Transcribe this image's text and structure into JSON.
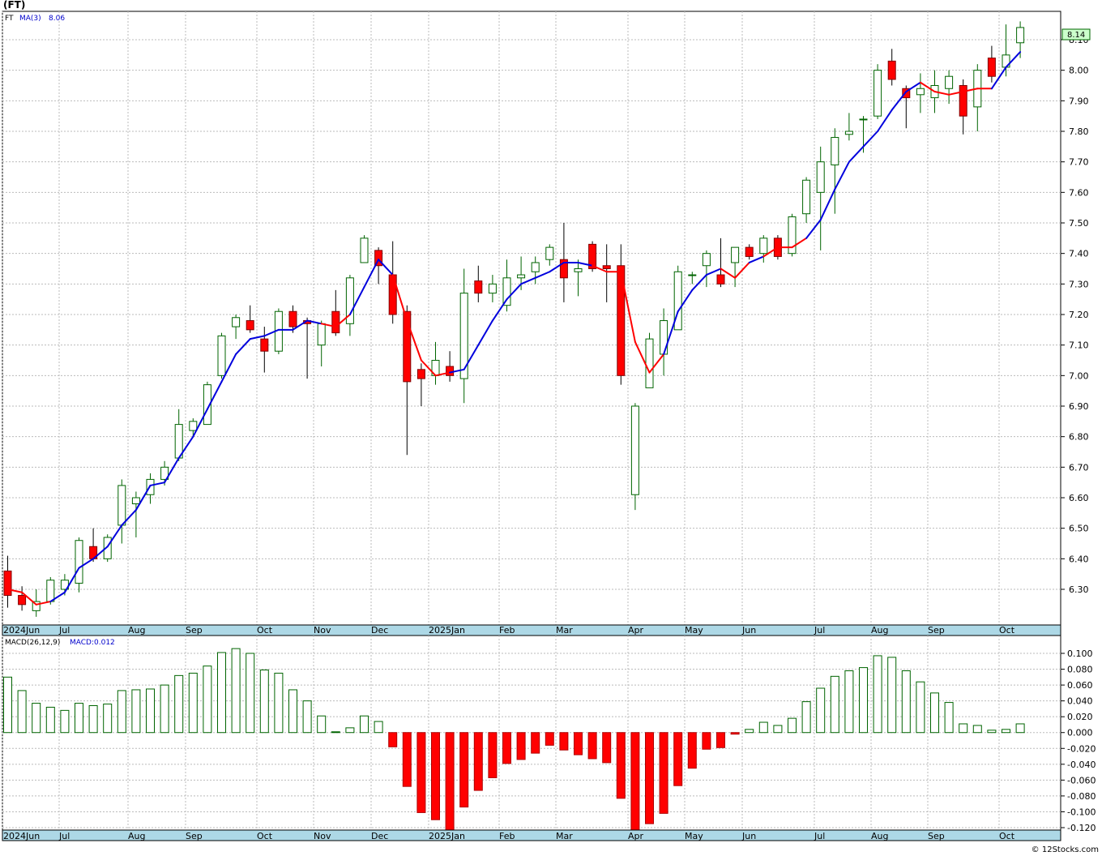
{
  "header": {
    "title": "(FT)",
    "symbol": "FT",
    "ma_label": "MA(3)",
    "ma_value": "8.06",
    "last_price": "8.14"
  },
  "macd_panel": {
    "label": "MACD(26,12,9)",
    "value_label": "MACD:0.012"
  },
  "footer": {
    "credit": "© 12Stocks.com"
  },
  "colors": {
    "up_candle_fill": "#ffffff",
    "up_candle_stroke": "#006400",
    "down_candle": "#ff0000",
    "ma_up": "#0000dd",
    "ma_down": "#ff0000",
    "macd_positive": "#006400",
    "macd_negative": "#ff0000",
    "axis_strip": "#add8e6",
    "last_price_bg": "#ccffcc"
  },
  "chart_data": [
    {
      "type": "candlestick",
      "title": "(FT)",
      "ylim": [
        6.2,
        8.2
      ],
      "y_ticks": [
        "6.30",
        "6.40",
        "6.50",
        "6.60",
        "6.70",
        "6.80",
        "6.90",
        "7.00",
        "7.10",
        "7.20",
        "7.30",
        "7.40",
        "7.50",
        "7.60",
        "7.70",
        "7.80",
        "7.90",
        "8.00",
        "8.10"
      ],
      "x_labels": [
        "2024Jun",
        "Jul",
        "Aug",
        "Sep",
        "Oct",
        "Nov",
        "Dec",
        "2025Jan",
        "Feb",
        "Mar",
        "Apr",
        "May",
        "Jun",
        "Jul",
        "Aug",
        "Sep",
        "Oct"
      ],
      "grid": true,
      "candles": [
        {
          "o": 6.36,
          "h": 6.41,
          "l": 6.24,
          "c": 6.28
        },
        {
          "o": 6.28,
          "h": 6.31,
          "l": 6.23,
          "c": 6.25
        },
        {
          "o": 6.23,
          "h": 6.3,
          "l": 6.21,
          "c": 6.26
        },
        {
          "o": 6.26,
          "h": 6.34,
          "l": 6.25,
          "c": 6.33
        },
        {
          "o": 6.3,
          "h": 6.35,
          "l": 6.28,
          "c": 6.33
        },
        {
          "o": 6.32,
          "h": 6.47,
          "l": 6.29,
          "c": 6.46
        },
        {
          "o": 6.44,
          "h": 6.5,
          "l": 6.39,
          "c": 6.4
        },
        {
          "o": 6.4,
          "h": 6.48,
          "l": 6.39,
          "c": 6.47
        },
        {
          "o": 6.51,
          "h": 6.66,
          "l": 6.45,
          "c": 6.64
        },
        {
          "o": 6.58,
          "h": 6.62,
          "l": 6.47,
          "c": 6.6
        },
        {
          "o": 6.61,
          "h": 6.68,
          "l": 6.58,
          "c": 6.66
        },
        {
          "o": 6.66,
          "h": 6.72,
          "l": 6.64,
          "c": 6.7
        },
        {
          "o": 6.73,
          "h": 6.89,
          "l": 6.72,
          "c": 6.84
        },
        {
          "o": 6.82,
          "h": 6.86,
          "l": 6.8,
          "c": 6.85
        },
        {
          "o": 6.84,
          "h": 6.98,
          "l": 6.84,
          "c": 6.97
        },
        {
          "o": 7.0,
          "h": 7.14,
          "l": 6.99,
          "c": 7.13
        },
        {
          "o": 7.16,
          "h": 7.2,
          "l": 7.12,
          "c": 7.19
        },
        {
          "o": 7.18,
          "h": 7.23,
          "l": 7.14,
          "c": 7.15
        },
        {
          "o": 7.12,
          "h": 7.16,
          "l": 7.01,
          "c": 7.08
        },
        {
          "o": 7.08,
          "h": 7.22,
          "l": 7.07,
          "c": 7.21
        },
        {
          "o": 7.21,
          "h": 7.23,
          "l": 7.14,
          "c": 7.16
        },
        {
          "o": 7.18,
          "h": 7.19,
          "l": 6.99,
          "c": 7.17
        },
        {
          "o": 7.1,
          "h": 7.18,
          "l": 7.03,
          "c": 7.17
        },
        {
          "o": 7.21,
          "h": 7.28,
          "l": 7.13,
          "c": 7.14
        },
        {
          "o": 7.17,
          "h": 7.33,
          "l": 7.13,
          "c": 7.32
        },
        {
          "o": 7.37,
          "h": 7.46,
          "l": 7.37,
          "c": 7.45
        },
        {
          "o": 7.41,
          "h": 7.42,
          "l": 7.3,
          "c": 7.36
        },
        {
          "o": 7.33,
          "h": 7.44,
          "l": 7.17,
          "c": 7.2
        },
        {
          "o": 7.21,
          "h": 7.23,
          "l": 6.74,
          "c": 6.98
        },
        {
          "o": 7.02,
          "h": 7.04,
          "l": 6.9,
          "c": 6.99
        },
        {
          "o": 7.0,
          "h": 7.11,
          "l": 6.97,
          "c": 7.05
        },
        {
          "o": 7.03,
          "h": 7.08,
          "l": 6.98,
          "c": 7.0
        },
        {
          "o": 6.99,
          "h": 7.35,
          "l": 6.91,
          "c": 7.27
        },
        {
          "o": 7.31,
          "h": 7.36,
          "l": 7.24,
          "c": 7.27
        },
        {
          "o": 7.27,
          "h": 7.33,
          "l": 7.24,
          "c": 7.3
        },
        {
          "o": 7.23,
          "h": 7.38,
          "l": 7.21,
          "c": 7.32
        },
        {
          "o": 7.32,
          "h": 7.39,
          "l": 7.28,
          "c": 7.33
        },
        {
          "o": 7.34,
          "h": 7.39,
          "l": 7.3,
          "c": 7.37
        },
        {
          "o": 7.38,
          "h": 7.43,
          "l": 7.36,
          "c": 7.42
        },
        {
          "o": 7.38,
          "h": 7.5,
          "l": 7.24,
          "c": 7.32
        },
        {
          "o": 7.34,
          "h": 7.38,
          "l": 7.26,
          "c": 7.35
        },
        {
          "o": 7.43,
          "h": 7.44,
          "l": 7.34,
          "c": 7.35
        },
        {
          "o": 7.36,
          "h": 7.43,
          "l": 7.24,
          "c": 7.35
        },
        {
          "o": 7.36,
          "h": 7.43,
          "l": 6.97,
          "c": 7.0
        },
        {
          "o": 6.61,
          "h": 6.91,
          "l": 6.56,
          "c": 6.9
        },
        {
          "o": 6.96,
          "h": 7.14,
          "l": 6.96,
          "c": 7.12
        },
        {
          "o": 7.07,
          "h": 7.22,
          "l": 7.0,
          "c": 7.18
        },
        {
          "o": 7.15,
          "h": 7.36,
          "l": 7.15,
          "c": 7.34
        },
        {
          "o": 7.33,
          "h": 7.34,
          "l": 7.3,
          "c": 7.33
        },
        {
          "o": 7.36,
          "h": 7.41,
          "l": 7.29,
          "c": 7.4
        },
        {
          "o": 7.33,
          "h": 7.45,
          "l": 7.29,
          "c": 7.3
        },
        {
          "o": 7.37,
          "h": 7.42,
          "l": 7.29,
          "c": 7.42
        },
        {
          "o": 7.42,
          "h": 7.43,
          "l": 7.38,
          "c": 7.39
        },
        {
          "o": 7.4,
          "h": 7.46,
          "l": 7.37,
          "c": 7.45
        },
        {
          "o": 7.45,
          "h": 7.46,
          "l": 7.38,
          "c": 7.39
        },
        {
          "o": 7.4,
          "h": 7.53,
          "l": 7.39,
          "c": 7.52
        },
        {
          "o": 7.53,
          "h": 7.65,
          "l": 7.5,
          "c": 7.64
        },
        {
          "o": 7.6,
          "h": 7.75,
          "l": 7.41,
          "c": 7.7
        },
        {
          "o": 7.69,
          "h": 7.81,
          "l": 7.53,
          "c": 7.78
        },
        {
          "o": 7.79,
          "h": 7.86,
          "l": 7.77,
          "c": 7.8
        },
        {
          "o": 7.84,
          "h": 7.85,
          "l": 7.73,
          "c": 7.84
        },
        {
          "o": 7.85,
          "h": 8.02,
          "l": 7.84,
          "c": 8.0
        },
        {
          "o": 8.03,
          "h": 8.07,
          "l": 7.95,
          "c": 7.97
        },
        {
          "o": 7.94,
          "h": 7.95,
          "l": 7.81,
          "c": 7.91
        },
        {
          "o": 7.92,
          "h": 7.99,
          "l": 7.86,
          "c": 7.94
        },
        {
          "o": 7.91,
          "h": 8.0,
          "l": 7.86,
          "c": 7.95
        },
        {
          "o": 7.94,
          "h": 8.0,
          "l": 7.89,
          "c": 7.98
        },
        {
          "o": 7.95,
          "h": 7.97,
          "l": 7.79,
          "c": 7.85
        },
        {
          "o": 7.88,
          "h": 8.02,
          "l": 7.8,
          "c": 8.0
        },
        {
          "o": 8.04,
          "h": 8.08,
          "l": 7.96,
          "c": 7.98
        },
        {
          "o": 8.01,
          "h": 8.15,
          "l": 7.98,
          "c": 8.05
        },
        {
          "o": 8.09,
          "h": 8.16,
          "l": 8.04,
          "c": 8.14
        }
      ],
      "ma3": [
        6.3,
        6.29,
        6.25,
        6.26,
        6.29,
        6.37,
        6.4,
        6.44,
        6.51,
        6.56,
        6.64,
        6.65,
        6.73,
        6.8,
        6.89,
        6.98,
        7.07,
        7.12,
        7.13,
        7.15,
        7.15,
        7.18,
        7.17,
        7.16,
        7.2,
        7.29,
        7.38,
        7.33,
        7.18,
        7.05,
        7.0,
        7.01,
        7.02,
        7.1,
        7.18,
        7.25,
        7.3,
        7.32,
        7.34,
        7.37,
        7.37,
        7.36,
        7.34,
        7.34,
        7.11,
        7.01,
        7.07,
        7.21,
        7.28,
        7.33,
        7.35,
        7.32,
        7.37,
        7.39,
        7.42,
        7.42,
        7.45,
        7.51,
        7.61,
        7.7,
        7.75,
        7.8,
        7.87,
        7.93,
        7.96,
        7.93,
        7.92,
        7.93,
        7.94,
        7.94,
        8.01,
        8.06
      ],
      "ma3_direction": [
        "down",
        "down",
        "down",
        "up",
        "up",
        "up",
        "up",
        "up",
        "up",
        "up",
        "up",
        "up",
        "up",
        "up",
        "up",
        "up",
        "up",
        "up",
        "up",
        "up",
        "up",
        "up",
        "down",
        "down",
        "up",
        "up",
        "up",
        "down",
        "down",
        "down",
        "down",
        "up",
        "up",
        "up",
        "up",
        "up",
        "up",
        "up",
        "up",
        "up",
        "up",
        "down",
        "down",
        "down",
        "down",
        "down",
        "up",
        "up",
        "up",
        "up",
        "down",
        "down",
        "up",
        "down",
        "down",
        "down",
        "up",
        "up",
        "up",
        "up",
        "up",
        "up",
        "up",
        "up",
        "down",
        "down",
        "down",
        "down",
        "down",
        "up",
        "up",
        "up"
      ]
    },
    {
      "type": "bar",
      "title": "MACD(26,12,9)",
      "ylim": [
        -0.125,
        0.1
      ],
      "y_ticks": [
        "0.100",
        "0.080",
        "0.060",
        "0.040",
        "0.020",
        "0.000",
        "-0.020",
        "-0.040",
        "-0.060",
        "-0.080",
        "-0.100",
        "-0.120"
      ],
      "x_labels": [
        "2024Jun",
        "Jul",
        "Aug",
        "Sep",
        "Oct",
        "Nov",
        "Dec",
        "2025Jan",
        "Feb",
        "Mar",
        "Apr",
        "May",
        "Jun",
        "Jul",
        "Aug",
        "Sep",
        "Oct"
      ],
      "values": [
        0.07,
        0.053,
        0.037,
        0.032,
        0.028,
        0.037,
        0.034,
        0.036,
        0.053,
        0.054,
        0.055,
        0.06,
        0.072,
        0.075,
        0.084,
        0.101,
        0.106,
        0.1,
        0.079,
        0.075,
        0.054,
        0.04,
        0.021,
        0.001,
        0.006,
        0.021,
        0.014,
        -0.018,
        -0.068,
        -0.101,
        -0.11,
        -0.131,
        -0.094,
        -0.073,
        -0.057,
        -0.039,
        -0.034,
        -0.026,
        -0.016,
        -0.022,
        -0.028,
        -0.033,
        -0.038,
        -0.083,
        -0.131,
        -0.115,
        -0.102,
        -0.067,
        -0.045,
        -0.021,
        -0.019,
        -0.002,
        0.004,
        0.013,
        0.009,
        0.018,
        0.039,
        0.056,
        0.071,
        0.078,
        0.082,
        0.097,
        0.095,
        0.078,
        0.064,
        0.05,
        0.038,
        0.011,
        0.009,
        0.003,
        0.004,
        0.011
      ],
      "grid": true
    }
  ]
}
